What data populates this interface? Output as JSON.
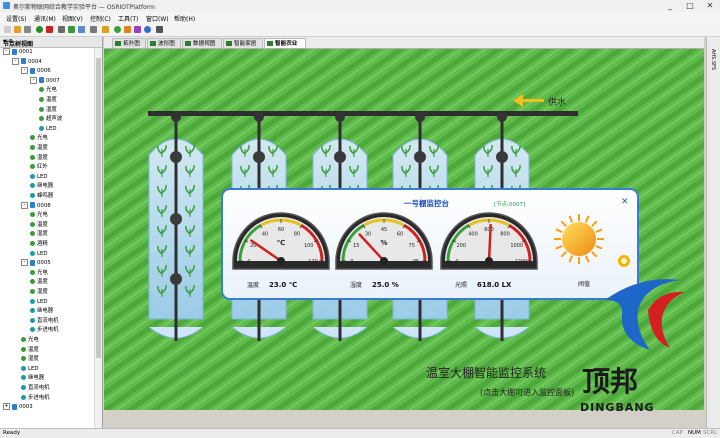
{
  "window": {
    "title": "奥尔斯物联网综合教学实验平台 — OSRIOTPlatform",
    "controls": [
      "_",
      "□",
      "✕"
    ]
  },
  "menu": [
    "设置(S)",
    "通讯(M)",
    "视图(V)",
    "控制(C)",
    "工具(T)",
    "窗口(W)",
    "帮助(H)"
  ],
  "sidebar": {
    "title": "节点树视图",
    "pin": "▾ ⊕",
    "close": "✕",
    "tree": [
      {
        "label": "0001",
        "icon": "antenna",
        "level": 0,
        "expand": "-"
      },
      {
        "label": "0004",
        "icon": "antenna",
        "level": 1,
        "expand": "-"
      },
      {
        "label": "0006",
        "icon": "antenna",
        "level": 2,
        "expand": "-"
      },
      {
        "label": "0007",
        "icon": "antenna",
        "level": 3,
        "expand": "-"
      },
      {
        "label": "光电",
        "icon": "node",
        "level": 4
      },
      {
        "label": "温度",
        "icon": "node",
        "level": 4
      },
      {
        "label": "湿度",
        "icon": "node",
        "level": 4
      },
      {
        "label": "超声波",
        "icon": "node",
        "level": 4
      },
      {
        "label": "LED",
        "icon": "node-teal",
        "level": 4
      },
      {
        "label": "光电",
        "icon": "node",
        "level": 3
      },
      {
        "label": "温度",
        "icon": "node",
        "level": 3
      },
      {
        "label": "湿度",
        "icon": "node",
        "level": 3
      },
      {
        "label": "红外",
        "icon": "node",
        "level": 3
      },
      {
        "label": "LED",
        "icon": "node-teal",
        "level": 3
      },
      {
        "label": "继电器",
        "icon": "node-teal",
        "level": 3
      },
      {
        "label": "蜂鸣器",
        "icon": "node-teal",
        "level": 3
      },
      {
        "label": "0008",
        "icon": "antenna",
        "level": 2,
        "expand": "-"
      },
      {
        "label": "光电",
        "icon": "node",
        "level": 3
      },
      {
        "label": "温度",
        "icon": "node",
        "level": 3
      },
      {
        "label": "湿度",
        "icon": "node",
        "level": 3
      },
      {
        "label": "酒精",
        "icon": "node",
        "level": 3
      },
      {
        "label": "LED",
        "icon": "node-teal",
        "level": 3
      },
      {
        "label": "0005",
        "icon": "antenna",
        "level": 2,
        "expand": "-"
      },
      {
        "label": "光电",
        "icon": "node",
        "level": 3
      },
      {
        "label": "温度",
        "icon": "node",
        "level": 3
      },
      {
        "label": "湿度",
        "icon": "node",
        "level": 3
      },
      {
        "label": "LED",
        "icon": "node-teal",
        "level": 3
      },
      {
        "label": "继电器",
        "icon": "node-teal",
        "level": 3
      },
      {
        "label": "直流电机",
        "icon": "node-teal",
        "level": 3
      },
      {
        "label": "步进电机",
        "icon": "node-teal",
        "level": 3
      },
      {
        "label": "光电",
        "icon": "node",
        "level": 2
      },
      {
        "label": "温度",
        "icon": "node",
        "level": 2
      },
      {
        "label": "湿度",
        "icon": "node",
        "level": 2
      },
      {
        "label": "LED",
        "icon": "node-teal",
        "level": 2
      },
      {
        "label": "继电器",
        "icon": "node-teal",
        "level": 2
      },
      {
        "label": "直流电机",
        "icon": "node-teal",
        "level": 2
      },
      {
        "label": "步进电机",
        "icon": "node-teal",
        "level": 2
      },
      {
        "label": "0003",
        "icon": "antenna",
        "level": 0,
        "expand": "+"
      }
    ]
  },
  "tabs": [
    "拓扑图",
    "波形图",
    "数据视图",
    "智能家居",
    "智能农业"
  ],
  "right_strip": "AHS.SFS",
  "scene": {
    "supply_label": "供水",
    "caption_title": "温室大棚智能监控系统",
    "caption_sub": "(点击大棚可进入监控面板)"
  },
  "panel": {
    "title": "一号棚监控台",
    "node": "[节点:0007]",
    "close": "✕",
    "gauges": [
      {
        "id": "temp",
        "unit": "℃",
        "ticks": [
          "0",
          "20",
          "40",
          "60",
          "80",
          "100",
          "120"
        ],
        "min": 0,
        "max": 120,
        "value": 23.0,
        "label": "温度",
        "readout": "23.0 ℃"
      },
      {
        "id": "hum",
        "unit": "%",
        "ticks": [
          "0",
          "15",
          "30",
          "45",
          "60",
          "75",
          "95"
        ],
        "min": 0,
        "max": 95,
        "value": 25.0,
        "label": "湿度",
        "readout": "25.0 %"
      },
      {
        "id": "light",
        "unit": "",
        "ticks": [
          "0",
          "200",
          "400",
          "600",
          "800",
          "1000",
          "1200"
        ],
        "min": 0,
        "max": 1200,
        "value": 618.0,
        "label": "光照",
        "readout": "618.0 LX"
      }
    ],
    "sun_label": "阀值"
  },
  "brand": {
    "cn": "顶邦",
    "en": "DINGBANG"
  },
  "status": {
    "left": "Ready",
    "indicators": [
      "CAP",
      "NUM",
      "SCRL"
    ]
  },
  "colors": {
    "grass": "#5cb84a",
    "panel_border": "#3a7bd5",
    "needle": "#d02020",
    "title_blue": "#1a4fc0"
  }
}
